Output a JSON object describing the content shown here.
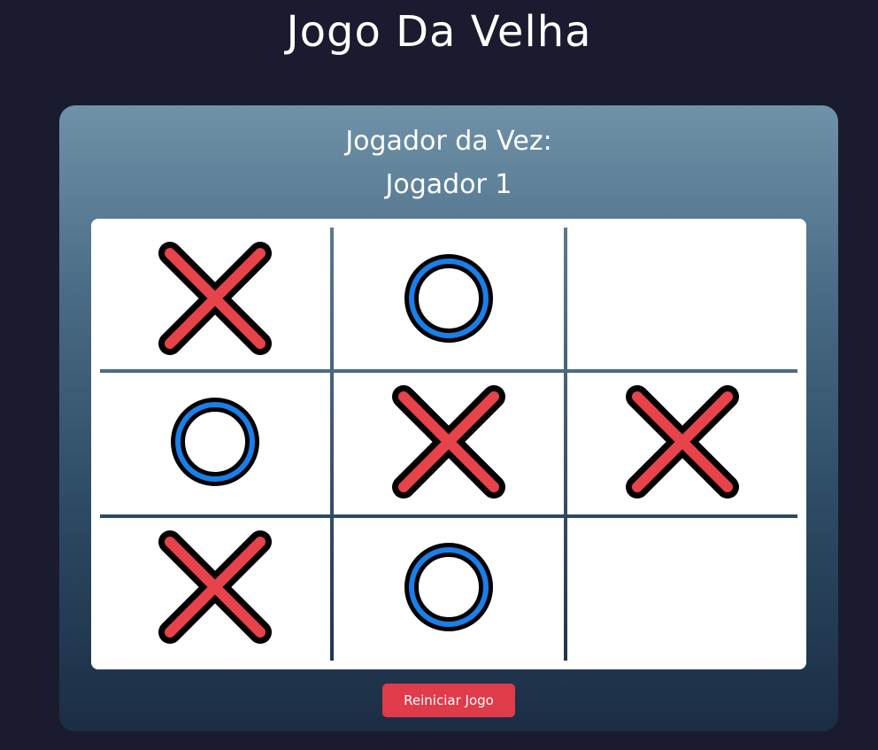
{
  "page": {
    "title": "Jogo Da Velha"
  },
  "turn": {
    "label": "Jogador da Vez:",
    "player": "Jogador 1"
  },
  "board": {
    "cells": [
      "X",
      "O",
      "",
      "O",
      "X",
      "X",
      "X",
      "O",
      ""
    ]
  },
  "colors": {
    "background": "#1b1b2f",
    "x_mark": "#e8424a",
    "o_mark": "#1a7fe8",
    "outline": "#000000",
    "reset_button": "#e03b4a"
  },
  "icons": {
    "x": "x-mark-icon",
    "o": "o-mark-icon"
  },
  "controls": {
    "reset_label": "Reiniciar Jogo"
  }
}
